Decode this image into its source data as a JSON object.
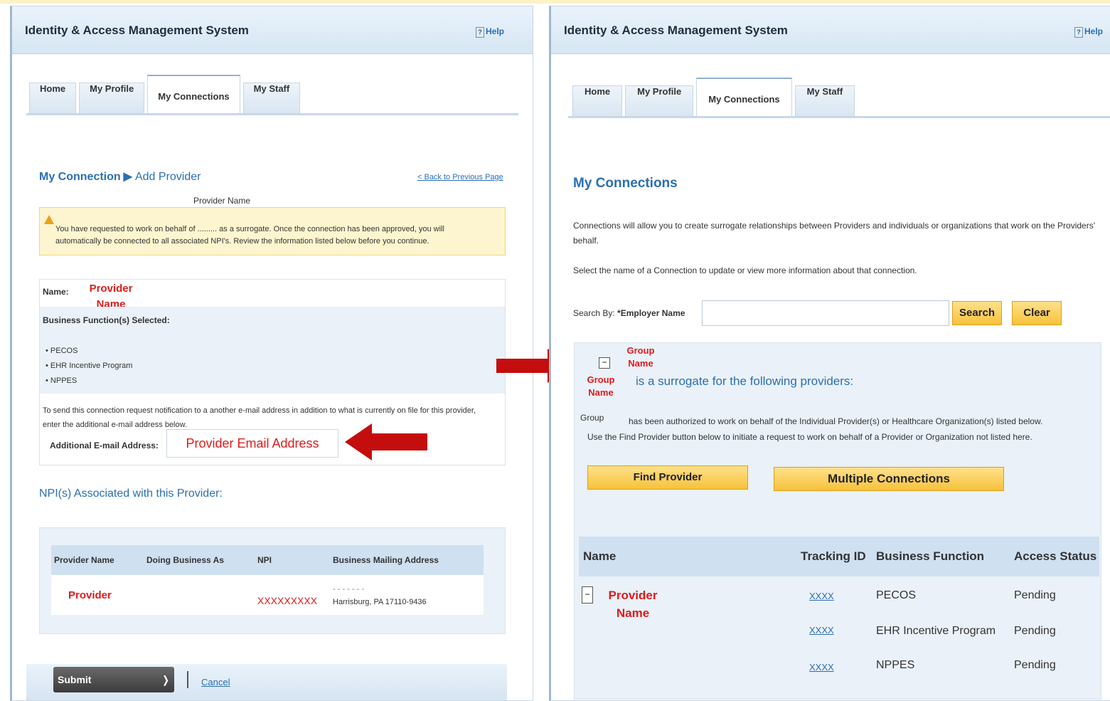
{
  "left": {
    "app_title": "Identity & Access Management System",
    "help_label": "Help",
    "tabs": [
      "Home",
      "My Profile",
      "My Connections",
      "My Staff"
    ],
    "breadcrumb": {
      "root": "My Connection",
      "separator": "▶",
      "current": "Add Provider"
    },
    "back_link": "< Back to Previous Page",
    "warning": {
      "line1_a": "You have requested to work on behalf of",
      "blank": ".........",
      "line1_b": "as a surrogate. Once the connection has been approved, you will",
      "line2": "automatically be connected to all associated NPI's. Review the information listed below before you continue.",
      "callout": "Provider Name"
    },
    "name_label": "Name:",
    "name_value": "Provider Name",
    "business_functions_label": "Business Function(s) Selected:",
    "business_functions": [
      "PECOS",
      "EHR Incentive Program",
      "NPPES"
    ],
    "email_note": "To send this connection request notification to a another e-mail address in addition to what is currently on file for this provider, enter the additional e-mail address below.",
    "additional_email_label": "Additional E-mail Address:",
    "additional_email_value": "Provider Email Address",
    "npi_heading": "NPI(s) Associated with this Provider:",
    "table_headers": [
      "Provider Name",
      "Doing Business As",
      "NPI",
      "Business Mailing Address"
    ],
    "table_row": {
      "provider": "Provider",
      "dba": "",
      "npi": "XXXXXXXXX",
      "address_line1": "- - - - - - -",
      "address_line2": "Harrisburg, PA 17110-9436"
    },
    "submit_label": "Submit",
    "cancel_label": "Cancel"
  },
  "right": {
    "app_title": "Identity & Access Management System",
    "help_label": "Help",
    "tabs": [
      "Home",
      "My Profile",
      "My Connections",
      "My Staff"
    ],
    "page_title": "My Connections",
    "intro_1": "Connections will allow you to create surrogate relationships between Providers and individuals or organizations that work on the Providers' behalf.",
    "intro_2": "Select the name of a Connection to update or view more information about that connection.",
    "search_by_label": "Search By:",
    "search_field_label": "*Employer Name",
    "search_value": "",
    "search_button": "Search",
    "clear_button": "Clear",
    "group_name_top": "Group Name",
    "group_name_left": "Group Name",
    "surrogate_text": "is a surrogate for the following providers:",
    "group_word": "Group",
    "authorized_text": "has been authorized to work on behalf of the Individual Provider(s) or Healthcare Organization(s) listed below.",
    "find_provider_hint": "Use the Find Provider button below to initiate a request to work on behalf of a Provider or Organization not listed here.",
    "find_provider_button": "Find Provider",
    "multiple_connections_button": "Multiple Connections",
    "table_headers": [
      "Name",
      "Tracking ID",
      "Business Function",
      "Access Status"
    ],
    "provider_name": "Provider Name",
    "rows": [
      {
        "tracking": "XXXX",
        "function": "PECOS",
        "status": "Pending"
      },
      {
        "tracking": "XXXX",
        "function": "EHR Incentive Program",
        "status": "Pending"
      },
      {
        "tracking": "XXXX",
        "function": "NPPES",
        "status": "Pending"
      }
    ]
  },
  "colors": {
    "accent_blue": "#2a6fb2",
    "red_annotation": "#e01b1b",
    "button_yellow": "#f6c23b",
    "warning_bg": "#fdf5cf",
    "arrow_red": "#c40d0d"
  }
}
